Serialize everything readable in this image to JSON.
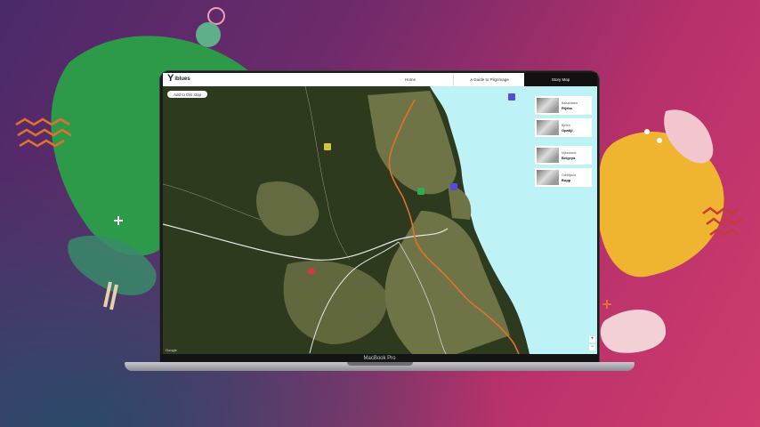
{
  "nav": {
    "logo_text": "iblues",
    "tabs": [
      {
        "label": "Home"
      },
      {
        "label": "A Guide to Pilgrimage"
      },
      {
        "label": "Story Map"
      }
    ]
  },
  "map": {
    "add_stop_label": "Add to this stop",
    "google_label": "Google",
    "zoom_in": "+",
    "zoom_out": "−"
  },
  "stops": [
    {
      "subtitle": "Bahaullaine",
      "name": "Rijeka"
    },
    {
      "subtitle": "Bjelen",
      "name": "Opatijl"
    },
    {
      "subtitle": "Mjezolanic",
      "name": "Belgeya"
    },
    {
      "subtitle": "Odntrijaco",
      "name": "Bopp"
    }
  ],
  "device": {
    "model_label": "MacBook Pro"
  },
  "colors": {
    "map_land": "#2d3a1e",
    "map_urban": "#6f7446",
    "map_water": "#bdf3f7",
    "route": "#e2712b",
    "marker_green": "#2cae4a",
    "marker_blue": "#5a4bd6",
    "marker_yellow": "#d9c23a",
    "marker_red": "#d8363b"
  }
}
